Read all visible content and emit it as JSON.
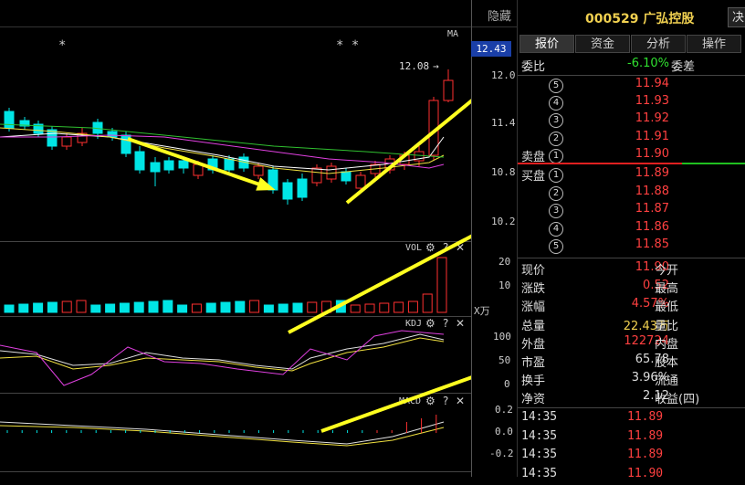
{
  "chart": {
    "hide_label": "隐藏",
    "ma_label": "MA",
    "current_price_tag": "12.43",
    "high_label": "12.08",
    "stars_left": "*",
    "stars_right": "* *",
    "y_axis_price": [
      "12.0",
      "11.4",
      "10.8",
      "10.2"
    ],
    "vol_title": "VOL",
    "vol_axis": [
      "20",
      "10",
      "X万"
    ],
    "kdj_title": "KDJ",
    "kdj_axis": [
      "100",
      "50",
      "0"
    ],
    "macd_title": "MACD",
    "macd_axis": [
      "0.2",
      "0.0",
      "-0.2"
    ],
    "gear_icon": "⚙",
    "help_icon": "?",
    "close_icon": "✕",
    "colors": {
      "up": "#ff3030",
      "down": "#00e5e5",
      "ma5": "#ffffff",
      "ma10": "#f0e040",
      "ma20": "#e040e0",
      "ma60": "#30c030",
      "arrow": "#ffff20"
    }
  },
  "panel": {
    "stock_code": "000529",
    "stock_name": "广弘控股",
    "decide_label": "决",
    "tabs": [
      "报价",
      "资金",
      "分析",
      "操作"
    ],
    "wei_bi": {
      "label": "委比",
      "value": "-6.10%",
      "label2": "委差"
    },
    "asks": [
      {
        "num": "5",
        "price": "11.94"
      },
      {
        "num": "4",
        "price": "11.93"
      },
      {
        "num": "3",
        "price": "11.92"
      },
      {
        "num": "2",
        "price": "11.91"
      },
      {
        "num": "1",
        "label": "卖盘",
        "price": "11.90"
      }
    ],
    "bids": [
      {
        "num": "1",
        "label": "买盘",
        "price": "11.89"
      },
      {
        "num": "2",
        "price": "11.88"
      },
      {
        "num": "3",
        "price": "11.87"
      },
      {
        "num": "4",
        "price": "11.86"
      },
      {
        "num": "5",
        "price": "11.85"
      }
    ],
    "stats": [
      {
        "l1": "现价",
        "v": "11.90",
        "l2": "今开",
        "color": "red"
      },
      {
        "l1": "涨跌",
        "v": "0.52",
        "l2": "最高",
        "color": "red"
      },
      {
        "l1": "涨幅",
        "v": "4.57%",
        "l2": "最低",
        "color": "red"
      },
      {
        "l1": "总量",
        "v": "22.43万",
        "l2": "量比",
        "color": "yellow"
      },
      {
        "l1": "外盘",
        "v": "122724",
        "l2": "内盘",
        "color": "red"
      },
      {
        "l1": "市盈",
        "v": "65.78",
        "l2": "股本",
        "color": "white"
      },
      {
        "l1": "换手",
        "v": "3.96%",
        "l2": "流通",
        "color": "white"
      },
      {
        "l1": "净资",
        "v": "2.12",
        "l2": "收益(四)",
        "color": "white"
      }
    ],
    "ticks": [
      {
        "time": "14:35",
        "price": "11.89"
      },
      {
        "time": "14:35",
        "price": "11.89"
      },
      {
        "time": "14:35",
        "price": "11.89"
      },
      {
        "time": "14:35",
        "price": "11.90"
      }
    ]
  }
}
